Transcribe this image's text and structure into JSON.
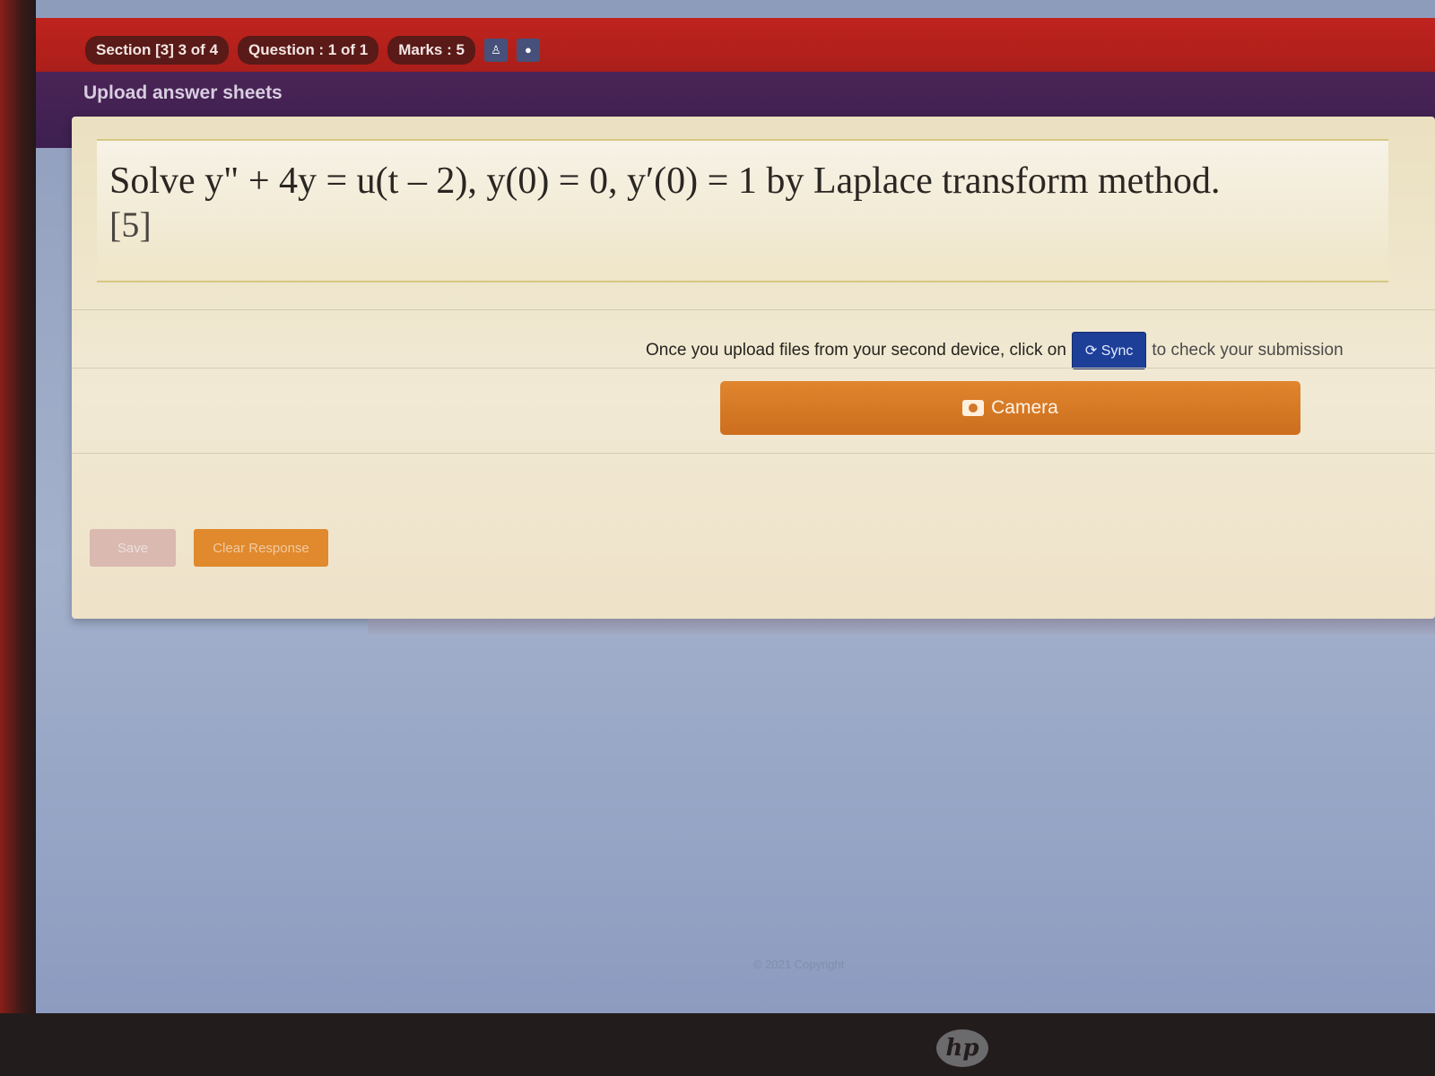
{
  "header": {
    "pills": [
      {
        "label": "Section [3] 3 of 4"
      },
      {
        "label": "Question : 1 of 1"
      },
      {
        "label": "Marks : 5"
      }
    ],
    "icons": [
      "user-icon",
      "chat-icon"
    ],
    "subtitle": "Upload answer sheets"
  },
  "question": {
    "text": "Solve y\" + 4y = u(t – 2), y(0) = 0, y′(0) = 1 by Laplace transform method.",
    "marks": "[5]"
  },
  "upload": {
    "instruction_before": "Once you upload files from your second device, click on",
    "sync_label": "Sync",
    "instruction_after": "to check your submission",
    "camera_label": "Camera"
  },
  "actions": {
    "save_label": "Save",
    "clear_label": "Clear Response"
  },
  "footer": {
    "copyright": "© 2021 Copyright"
  },
  "colors": {
    "header_red": "#c0231e",
    "header_purple": "#4a2456",
    "sync_blue": "#1d3f98",
    "camera_orange": "#e0862e"
  }
}
